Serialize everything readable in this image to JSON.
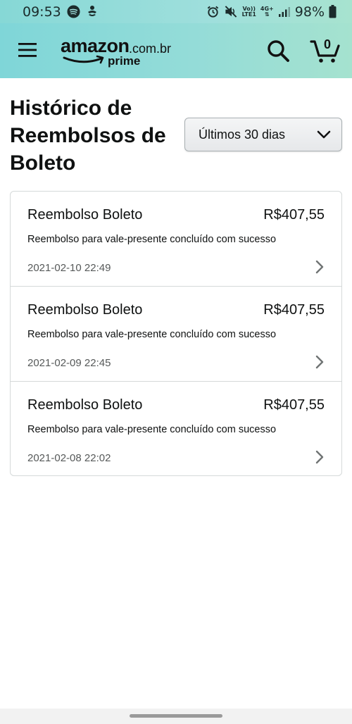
{
  "status_bar": {
    "time": "09:53",
    "battery": "98%",
    "volte_top": "Vo))",
    "volte_bottom": "LTE1",
    "network_top": "4G+",
    "network_bottom": "⇅",
    "icons": [
      "spotify-icon",
      "app-notification-icon",
      "alarm-icon",
      "mute-icon",
      "volte-icon",
      "4g-icon",
      "signal-icon",
      "battery-icon"
    ]
  },
  "header": {
    "logo_main": "amazon",
    "logo_suffix": ".com.br",
    "logo_prime": "prime",
    "cart_count": "0",
    "icons": [
      "menu-icon",
      "search-icon",
      "cart-icon"
    ],
    "accent_color": "#8fdad9"
  },
  "page": {
    "title": "Histórico de Reembolsos de Boleto",
    "filter": {
      "selected": "Últimos 30 dias"
    }
  },
  "refunds": [
    {
      "title": "Reembolso Boleto",
      "amount": "R$407,55",
      "description": "Reembolso para vale-presente concluído com sucesso",
      "date": "2021-02-10 22:49"
    },
    {
      "title": "Reembolso Boleto",
      "amount": "R$407,55",
      "description": "Reembolso para vale-presente concluído com sucesso",
      "date": "2021-02-09 22:45"
    },
    {
      "title": "Reembolso Boleto",
      "amount": "R$407,55",
      "description": "Reembolso para vale-presente concluído com sucesso",
      "date": "2021-02-08 22:02"
    }
  ]
}
